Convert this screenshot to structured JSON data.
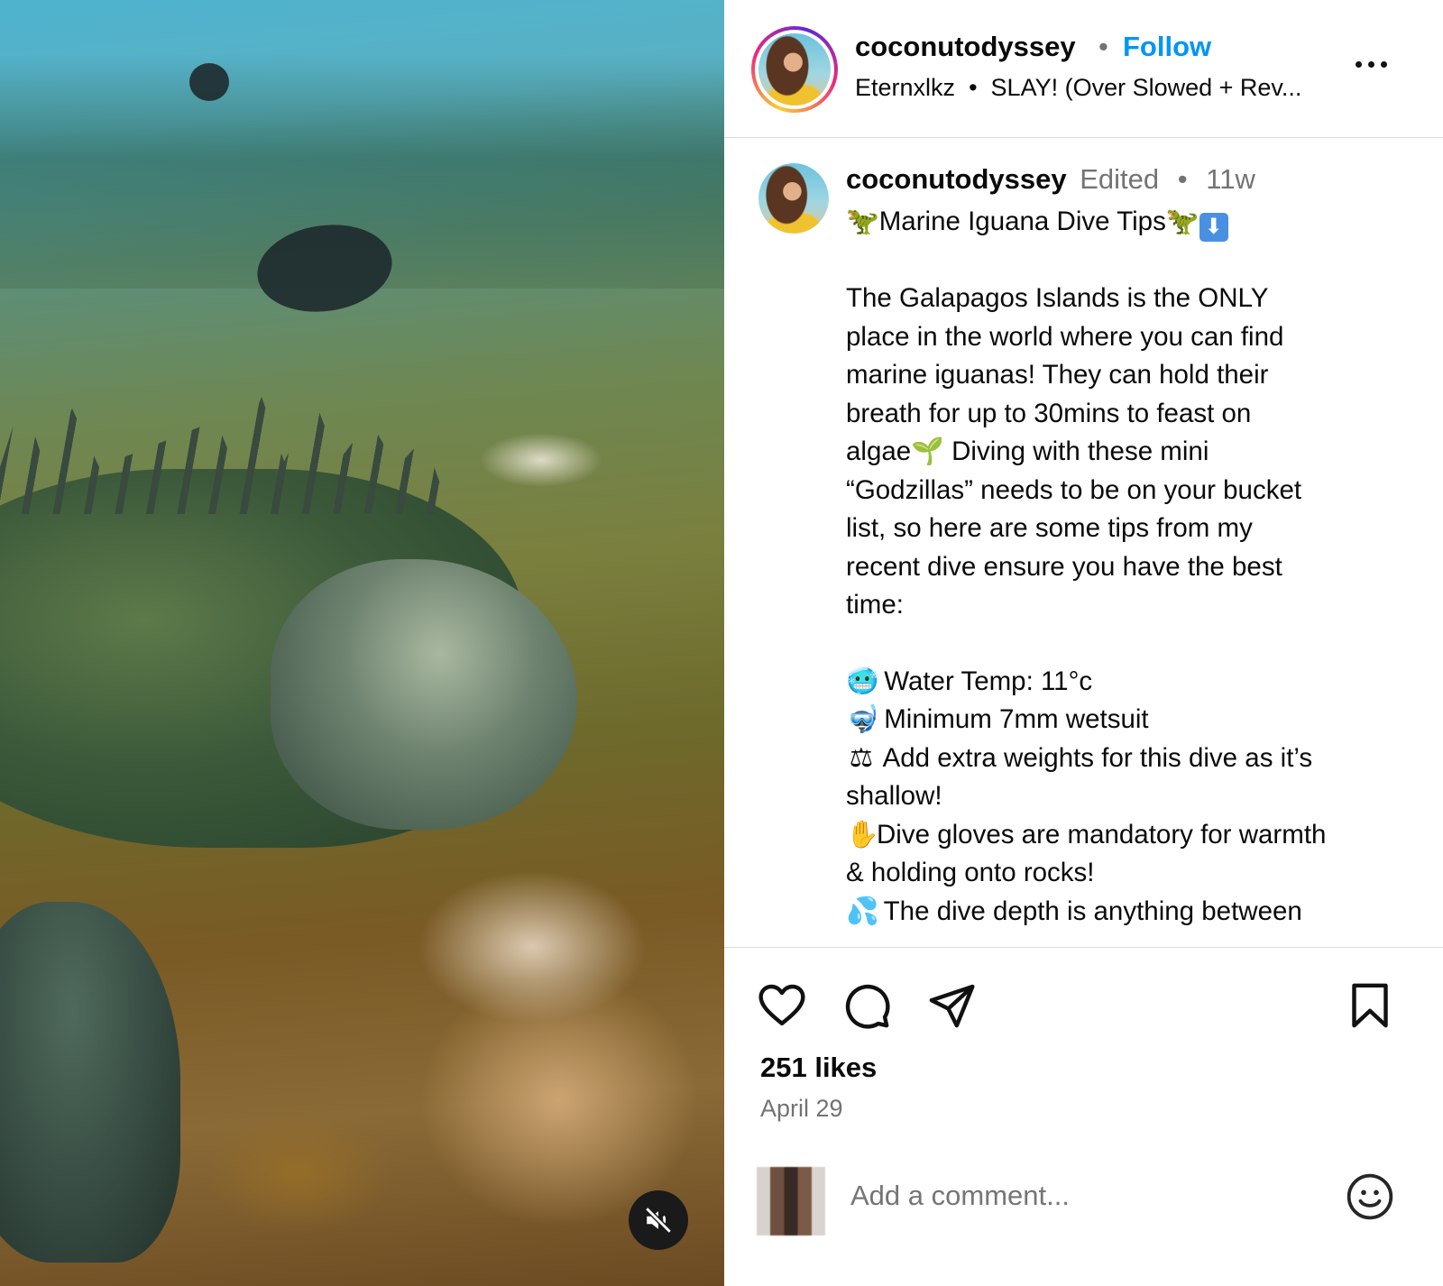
{
  "post": {
    "username": "coconutodyssey",
    "follow_label": "Follow",
    "audio_artist": "Eternxlkz",
    "audio_title": "SLAY! (Over Slowed + Rev...",
    "more_label": "...",
    "caption": {
      "username": "coconutodyssey",
      "edited_label": "Edited",
      "time_ago": "11w",
      "title": "Marine Iguana Dive Tips",
      "paragraph_lines": [
        "The Galapagos Islands is the ONLY",
        "place in the world where you can find",
        "marine iguanas! They can hold their",
        "breath for up to 30mins to feast on"
      ],
      "algae_line_a": "algae",
      "algae_line_b": " Diving with these mini",
      "paragraph_lines_2": [
        "“Godzillas” needs to be on your bucket",
        "list, so here are some tips from my",
        "recent dive ensure you have the best",
        "time:"
      ],
      "tips": [
        {
          "icon": "cold-face-emoji",
          "text": " Water Temp: 11°c"
        },
        {
          "icon": "diving-mask-emoji",
          "text": " Minimum 7mm wetsuit"
        },
        {
          "icon": "balance-scale-emoji",
          "text": " Add extra weights for this dive as it’s"
        },
        {
          "icon": "",
          "text": "shallow!"
        },
        {
          "icon": "glove-emoji",
          "text": "Dive gloves are mandatory for warmth"
        },
        {
          "icon": "",
          "text": "& holding onto rocks!"
        },
        {
          "icon": "droplets-emoji",
          "text": " The dive depth is anything between"
        }
      ]
    },
    "likes": "251 likes",
    "date": "April 29",
    "comment_placeholder": "Add a comment..."
  },
  "colors": {
    "follow_blue": "#0095f6",
    "muted_text": "#737373",
    "divider": "#dbdbdb"
  },
  "icons": {
    "mute": "speaker-muted-icon",
    "like": "heart-icon",
    "comment": "comment-bubble-icon",
    "share": "paper-plane-icon",
    "save": "bookmark-icon",
    "emoji": "smiley-icon",
    "more": "more-options-icon"
  }
}
